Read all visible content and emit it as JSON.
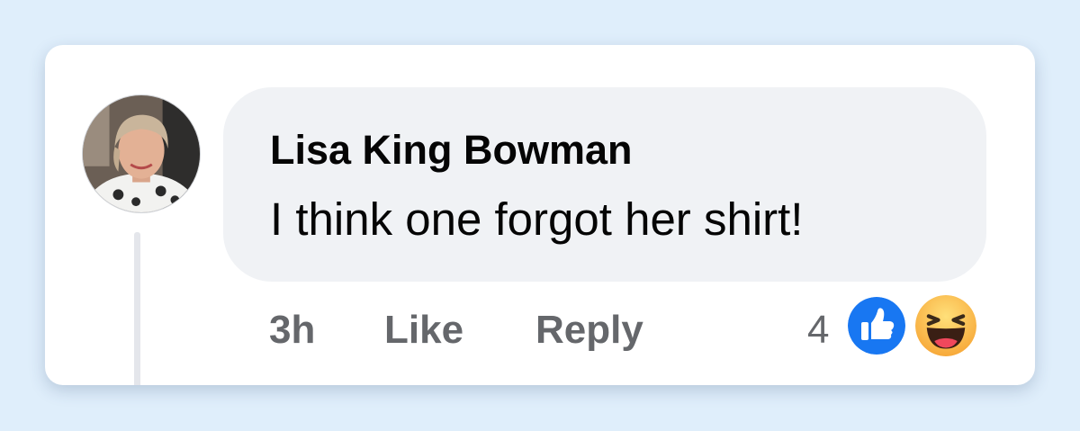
{
  "comment": {
    "author": "Lisa King Bowman",
    "text": "I think one forgot her shirt!",
    "time": "3h",
    "like_label": "Like",
    "reply_label": "Reply",
    "reaction_count": "4",
    "reactions": [
      "like-reaction-icon",
      "haha-reaction-icon"
    ]
  },
  "colors": {
    "bubble_bg": "#f0f2f5",
    "like_blue": "#1877f2",
    "action_gray": "#65676b",
    "page_bg": "#dfeefb"
  }
}
